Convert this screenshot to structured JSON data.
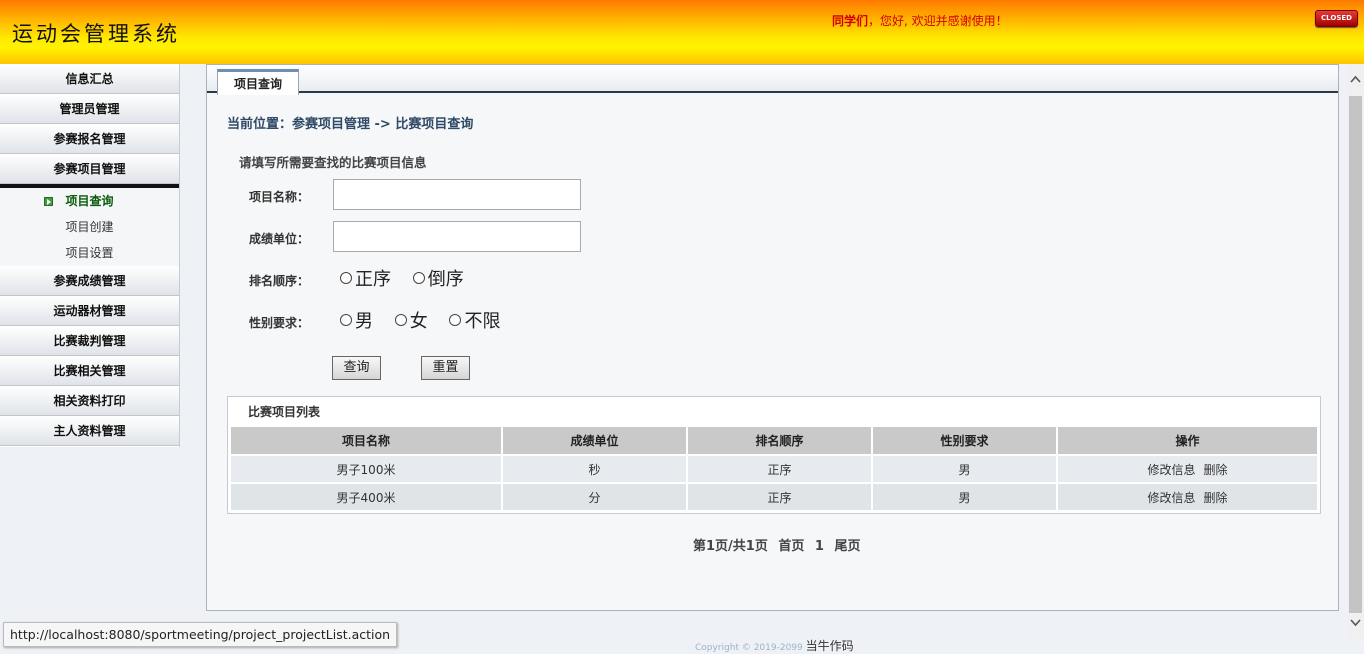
{
  "header": {
    "app_title": "运动会管理系统",
    "welcome_name": "同学们",
    "welcome_text": "，您好, 欢迎并感谢使用！",
    "closed_label": "CLOSED"
  },
  "sidebar": {
    "items": [
      {
        "label": "信息汇总"
      },
      {
        "label": "管理员管理"
      },
      {
        "label": "参赛报名管理"
      },
      {
        "label": "参赛项目管理"
      }
    ],
    "sub_items": [
      {
        "label": "项目查询"
      },
      {
        "label": "项目创建"
      },
      {
        "label": "项目设置"
      }
    ],
    "items_after": [
      {
        "label": "参赛成绩管理"
      },
      {
        "label": "运动器材管理"
      },
      {
        "label": "比赛裁判管理"
      },
      {
        "label": "比赛相关管理"
      },
      {
        "label": "相关资料打印"
      },
      {
        "label": "主人资料管理"
      }
    ]
  },
  "main": {
    "tab_label": "项目查询",
    "breadcrumb": "当前位置：参赛项目管理 -> 比赛项目查询",
    "form": {
      "title": "请填写所需要查找的比赛项目信息",
      "name_label": "项目名称：",
      "name_value": "",
      "unit_label": "成绩单位：",
      "unit_value": "",
      "order_label": "排名顺序：",
      "order_options": [
        "正序",
        "倒序"
      ],
      "gender_label": "性别要求：",
      "gender_options": [
        "男",
        "女",
        "不限"
      ],
      "search_button": "查询",
      "reset_button": "重置"
    },
    "list": {
      "title": "比赛项目列表",
      "columns": [
        "项目名称",
        "成绩单位",
        "排名顺序",
        "性别要求",
        "操作"
      ],
      "rows": [
        {
          "name": "男子100米",
          "unit": "秒",
          "order": "正序",
          "gender": "男",
          "edit": "修改信息",
          "delete": "删除"
        },
        {
          "name": "男子400米",
          "unit": "分",
          "order": "正序",
          "gender": "男",
          "edit": "修改信息",
          "delete": "删除"
        }
      ]
    },
    "pager": {
      "info": "第1页/共1页",
      "first": "首页",
      "current": "1",
      "last": "尾页"
    }
  },
  "footer": {
    "copyright": "Copyright © 2019-2099",
    "author": "当牛作码"
  },
  "status_url": "http://localhost:8080/sportmeeting/project_projectList.action"
}
